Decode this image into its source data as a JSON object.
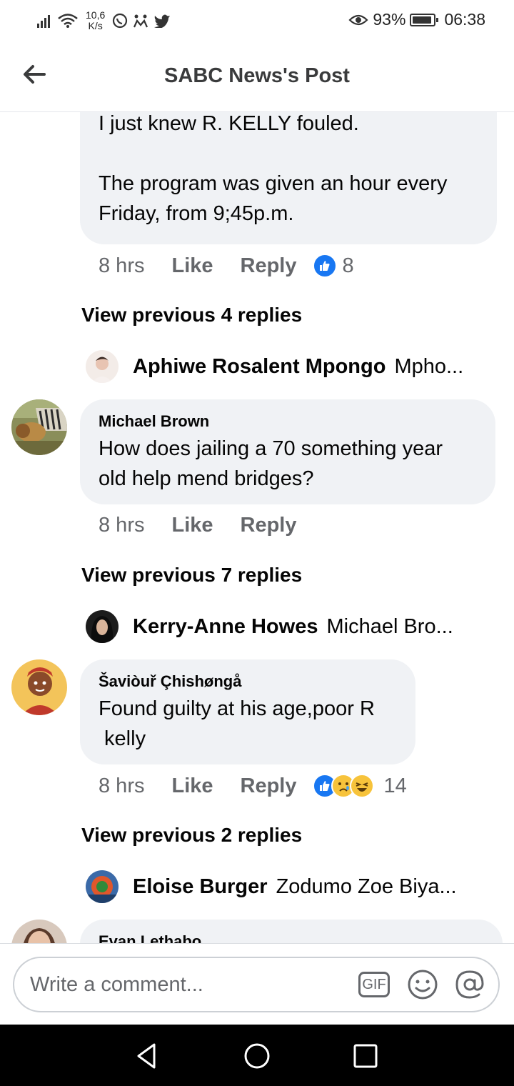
{
  "status_bar": {
    "speed_value": "10,6",
    "speed_unit": "K/s",
    "battery_percent": "93%",
    "battery_level": 0.93,
    "time": "06:38"
  },
  "header": {
    "title": "SABC News's Post"
  },
  "comments": [
    {
      "text_line1": "I just knew R. KELLY fouled.",
      "text_line2": "The program was given an hour every",
      "text_line3": "Friday, from 9;45p.m.",
      "time": "8 hrs",
      "like_label": "Like",
      "reply_label": "Reply",
      "reaction_count": "8",
      "view_previous": "View previous 4 replies",
      "latest_reply": {
        "name": "Aphiwe Rosalent Mpongo",
        "snippet": "Mpho..."
      }
    },
    {
      "author": "Michael Brown",
      "text_line1": "How does jailing a 70 something year",
      "text_line2": "old help mend bridges?",
      "time": "8 hrs",
      "like_label": "Like",
      "reply_label": "Reply",
      "view_previous": "View previous 7 replies",
      "latest_reply": {
        "name": "Kerry-Anne Howes",
        "snippet": "Michael Bro..."
      }
    },
    {
      "author": "Šaviòuř Çhishøngå",
      "text_line1": "Found guilty at his age,poor R",
      "text_line2": " kelly",
      "time": "8 hrs",
      "like_label": "Like",
      "reply_label": "Reply",
      "reaction_count": "14",
      "view_previous": "View previous 2 replies",
      "latest_reply": {
        "name": "Eloise Burger",
        "snippet": "Zodumo Zoe Biya..."
      }
    },
    {
      "author": "Evan Lethabo"
    }
  ],
  "composer": {
    "placeholder": "Write a comment...",
    "gif_label": "GIF"
  },
  "colors": {
    "bubble": "#f0f2f5",
    "like_blue": "#1877f2",
    "meta_gray": "#65676b"
  }
}
